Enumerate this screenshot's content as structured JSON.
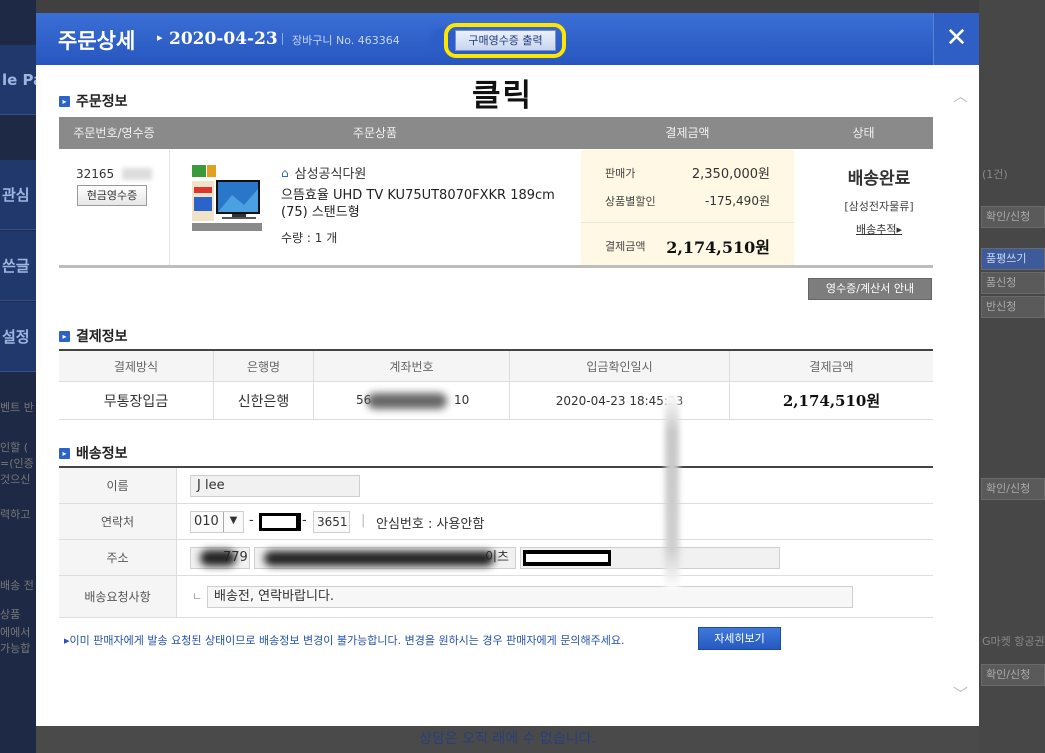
{
  "background": {
    "left_nav": [
      "le Pa",
      "관심",
      "쓴글",
      "설정"
    ],
    "left_texts": [
      "벤트 반",
      "인할 (",
      "=(인증",
      "것으신",
      "력하고",
      "배송 전",
      "상품",
      "에에서",
      "가능합"
    ],
    "right_texts": [
      "(1건)",
      "확인/신청",
      "품평쓰기",
      "품신청",
      "반신청",
      "확인/신청",
      "G마켓 항공권",
      "확인/신청"
    ],
    "bottom_text": "상담은 오직 래에 수 없습니다."
  },
  "modal": {
    "title": "주문상세",
    "date": "2020-04-23",
    "cart_label": "장바구니 No. 463364",
    "receipt_print_button": "구매영수증 출력",
    "close_icon": "✕",
    "annotation": "클릭"
  },
  "order_info": {
    "section_title": "주문정보",
    "headers": [
      "주문번호/영수증",
      "주문상품",
      "결제금액",
      "상태"
    ],
    "order_no": "32165",
    "cash_receipt_button": "현금영수증",
    "seller": "삼성공식다원",
    "product_name": "으뜸효율 UHD TV KU75UT8070FXKR 189cm (75) 스탠드형",
    "quantity": "수량 : 1 개",
    "sale_price_label": "판매가",
    "sale_price": "2,350,000원",
    "discount_label": "상품별할인",
    "discount": "-175,490원",
    "total_label": "결제금액",
    "total": "2,174,510원",
    "status": "배송완료",
    "carrier": "[삼성전자물류]",
    "tracking_link": "배송추적▸",
    "receipt_guide_button": "영수증/계산서 안내"
  },
  "payment_info": {
    "section_title": "결제정보",
    "headers": [
      "결제방식",
      "은행명",
      "계좌번호",
      "입금확인일시",
      "결제금액"
    ],
    "method": "무통장입금",
    "bank": "신한은행",
    "account_start": "56",
    "account_end": "10",
    "confirm_datetime": "2020-04-23 18:45:23",
    "amount": "2,174,510원"
  },
  "shipping_info": {
    "section_title": "배송정보",
    "labels": [
      "이름",
      "연락처",
      "주소",
      "배송요청사항"
    ],
    "name": "J lee",
    "phone_prefix": "010",
    "phone_last": "3651",
    "safe_number": "안심번호 : 사용안함",
    "address_part": "779",
    "address_suffix": "이츠",
    "request_marker": "ㄴ",
    "request": "배송전, 연락바랍니다.",
    "notice": "▸이미 판매자에게 발송 요청된 상태이므로 배송정보 변경이 불가능합니다. 변경을 원하시는 경우 판매자에게 문의해주세요.",
    "detail_button": "자세히보기"
  },
  "colors": {
    "header_blue": "#2b5ec8",
    "highlight_yellow": "#ffe600",
    "section_icon": "#2b63c9",
    "table_header_gray": "#8a8a8a"
  }
}
